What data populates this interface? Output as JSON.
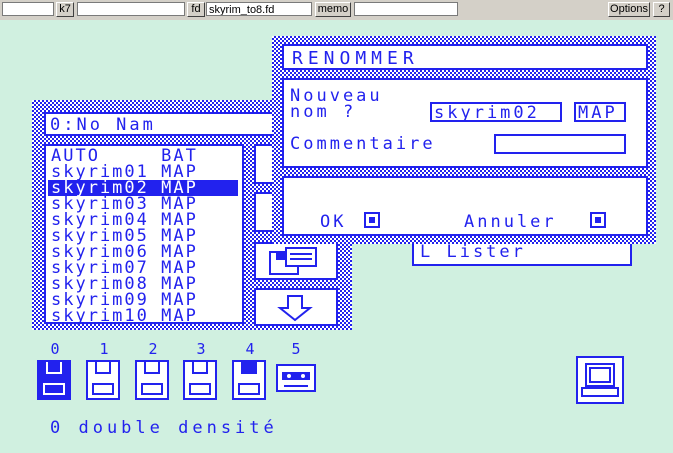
{
  "toolbar": {
    "k7_label": "k7",
    "fd_label": "fd",
    "fd_value": "skyrim_to8.fd",
    "memo_label": "memo",
    "options_label": "Options",
    "help_label": "?"
  },
  "back_panel": {
    "title": "0:No Nam",
    "files": [
      {
        "name": "AUTO    ",
        "ext": "BAT"
      },
      {
        "name": "skyrim01",
        "ext": "MAP"
      },
      {
        "name": "skyrim02",
        "ext": "MAP"
      },
      {
        "name": "skyrim03",
        "ext": "MAP"
      },
      {
        "name": "skyrim04",
        "ext": "MAP"
      },
      {
        "name": "skyrim05",
        "ext": "MAP"
      },
      {
        "name": "skyrim06",
        "ext": "MAP"
      },
      {
        "name": "skyrim07",
        "ext": "MAP"
      },
      {
        "name": "skyrim08",
        "ext": "MAP"
      },
      {
        "name": "skyrim09",
        "ext": "MAP"
      },
      {
        "name": "skyrim10",
        "ext": "MAP"
      }
    ],
    "selected_index": 2,
    "lister_label": "L Lister"
  },
  "dialog": {
    "title": "RENOMMER",
    "new_name_label_1": "Nouveau",
    "new_name_label_2": "nom ?",
    "new_name_value": "skyrim02",
    "new_ext_value": "MAP",
    "comment_label": "Commentaire",
    "comment_value": "",
    "ok_label": "OK",
    "cancel_label": "Annuler"
  },
  "drives": {
    "numbers": [
      "0",
      "1",
      "2",
      "3",
      "4",
      "5"
    ],
    "active_index": 0,
    "status": "0 double densité"
  },
  "colors": {
    "ui_blue": "#2222ee",
    "screen_bg": "#d0f0e0"
  }
}
